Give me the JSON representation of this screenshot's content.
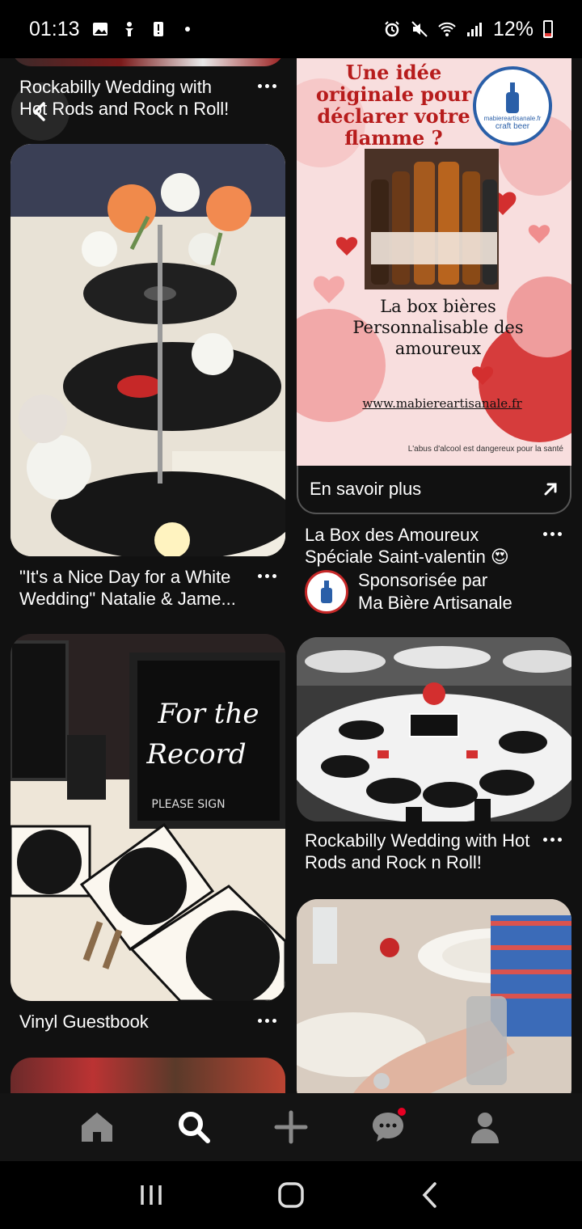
{
  "status_bar": {
    "time": "01:13",
    "battery_pct": "12%",
    "icons_left": [
      "gallery-icon",
      "accessibility-icon",
      "alert-icon",
      "dot-icon"
    ],
    "icons_right": [
      "alarm-icon",
      "mute-icon",
      "wifi-icon",
      "signal-icon",
      "battery-icon"
    ]
  },
  "feed": {
    "pins": [
      {
        "title": "Rockabilly Wedding with Hot Rods and Rock n Roll!"
      },
      {
        "title": "\"It's a Nice Day for a White Wedding\" Natalie & Jame..."
      },
      {
        "title": "Vinyl Guestbook"
      },
      {
        "title": "Rockabilly Wedding with Hot Rods and Rock n Roll!"
      }
    ],
    "ad": {
      "headline": "Une idée originale pour déclarer votre flamme ?",
      "product_text": "La box bières Personnalisable des amoureux",
      "url": "www.mabiereartisanale.fr",
      "disclaimer": "L'abus d'alcool est dangereux pour la santé",
      "logo_text": "mabiereartisanale.fr",
      "logo_sub": "craft beer",
      "cta": "En savoir plus",
      "title": "La Box des Amoureux Spéciale Saint-valentin 😍",
      "sponsor_prefix": "Sponsorisée par",
      "sponsor_name": "Ma Bière Artisanale"
    },
    "chalkboard": {
      "line1": "For the",
      "line2": "Record",
      "line3": "PLEASE SIGN"
    }
  },
  "bottom_nav": {
    "items": [
      "home-icon",
      "search-icon",
      "create-icon",
      "messages-icon",
      "profile-icon"
    ]
  },
  "colors": {
    "background": "#111111",
    "accent_red": "#e60023",
    "ad_pink": "#f7d7d7"
  }
}
